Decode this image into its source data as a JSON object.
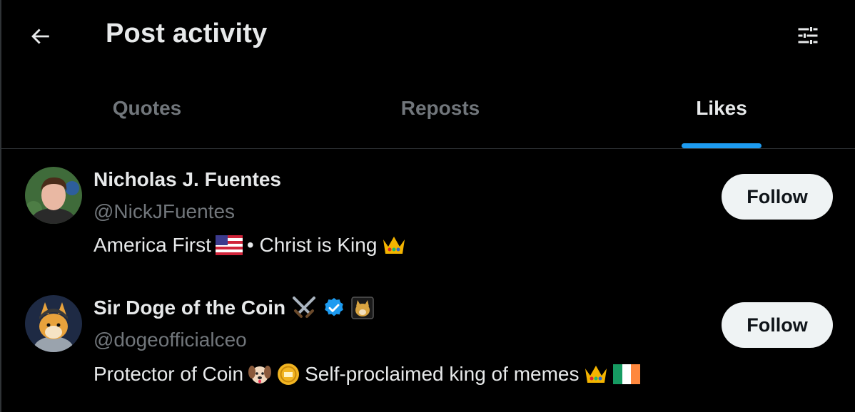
{
  "header": {
    "title": "Post activity",
    "back_icon": "arrow-left-icon",
    "filter_icon": "sliders-icon"
  },
  "tabs": [
    {
      "label": "Quotes",
      "active": false
    },
    {
      "label": "Reposts",
      "active": false
    },
    {
      "label": "Likes",
      "active": true
    }
  ],
  "accent_color": "#1d9bf0",
  "users": [
    {
      "name": "Nicholas J. Fuentes",
      "handle": "@NickJFuentes",
      "bio_parts": [
        "America First",
        "• Christ is King"
      ],
      "bio_icons": [
        "us-flag-icon",
        "crown-icon"
      ],
      "follow_label": "Follow"
    },
    {
      "name": "Sir Doge of the Coin",
      "name_icons": [
        "crossed-swords-icon",
        "verified-badge-icon",
        "doge-badge-icon"
      ],
      "handle": "@dogeofficialceo",
      "bio_parts": [
        "Protector of Coin",
        "Self-proclaimed king of memes"
      ],
      "bio_icons": [
        "dog-face-icon",
        "coin-icon",
        "crown-icon",
        "ireland-flag-icon"
      ],
      "follow_label": "Follow"
    }
  ]
}
